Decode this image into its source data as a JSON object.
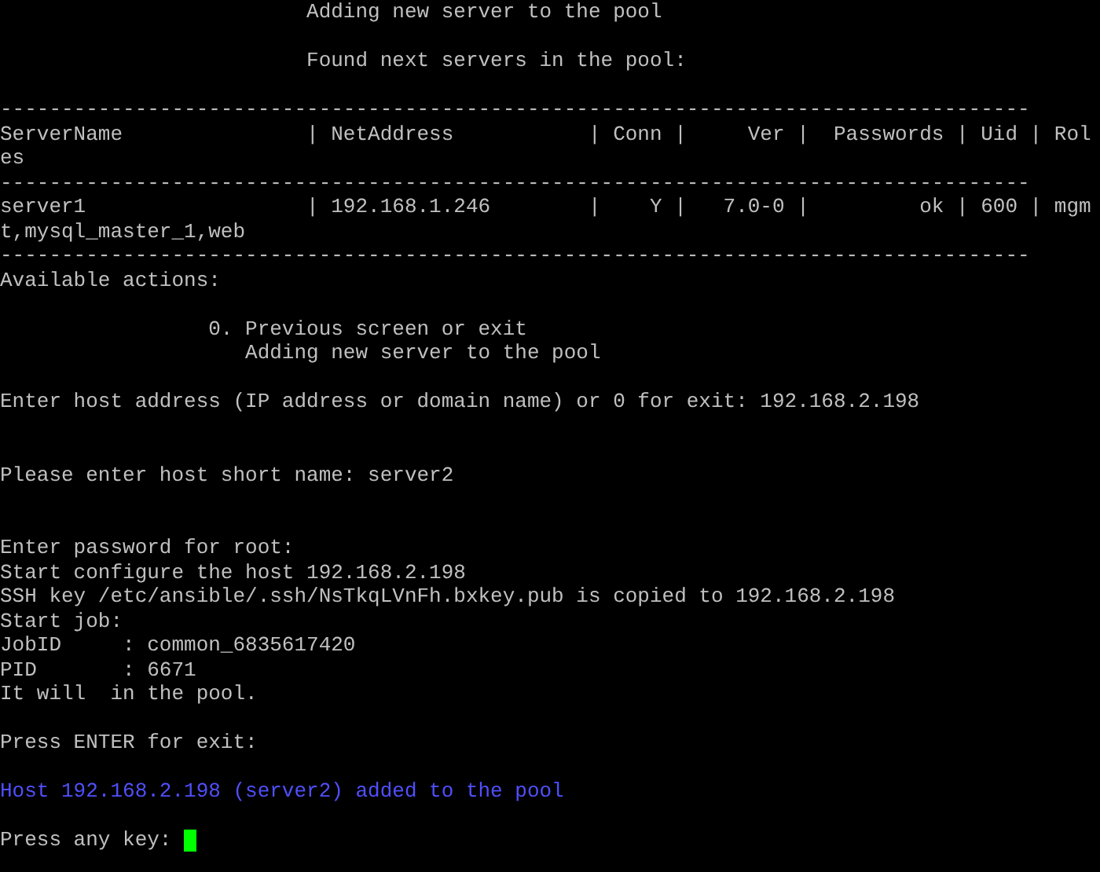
{
  "terminal": {
    "lines": [
      {
        "kind": "text",
        "text": "                         Adding new server to the pool"
      },
      {
        "kind": "blank"
      },
      {
        "kind": "text",
        "text": "                         Found next servers in the pool:"
      },
      {
        "kind": "blank"
      },
      {
        "kind": "text",
        "text": "------------------------------------------------------------------------------------"
      },
      {
        "kind": "text",
        "text": "ServerName               | NetAddress           | Conn |     Ver |  Passwords | Uid | Rol"
      },
      {
        "kind": "text",
        "text": "es"
      },
      {
        "kind": "text",
        "text": "------------------------------------------------------------------------------------"
      },
      {
        "kind": "text",
        "text": "server1                  | 192.168.1.246        |    Y |   7.0-0 |         ok | 600 | mgm"
      },
      {
        "kind": "text",
        "text": "t,mysql_master_1,web"
      },
      {
        "kind": "text",
        "text": "------------------------------------------------------------------------------------"
      },
      {
        "kind": "text",
        "text": "Available actions:"
      },
      {
        "kind": "blank"
      },
      {
        "kind": "text",
        "text": "                 0. Previous screen or exit"
      },
      {
        "kind": "text",
        "text": "                    Adding new server to the pool"
      },
      {
        "kind": "blank"
      },
      {
        "kind": "text",
        "text": "Enter host address (IP address or domain name) or 0 for exit: 192.168.2.198"
      },
      {
        "kind": "blank"
      },
      {
        "kind": "blank"
      },
      {
        "kind": "text",
        "text": "Please enter host short name: server2"
      },
      {
        "kind": "blank"
      },
      {
        "kind": "blank"
      },
      {
        "kind": "text",
        "text": "Enter password for root:"
      },
      {
        "kind": "text",
        "text": "Start configure the host 192.168.2.198"
      },
      {
        "kind": "text",
        "text": "SSH key /etc/ansible/.ssh/NsTkqLVnFh.bxkey.pub is copied to 192.168.2.198"
      },
      {
        "kind": "text",
        "text": "Start job:"
      },
      {
        "kind": "text",
        "text": "JobID     : common_6835617420"
      },
      {
        "kind": "text",
        "text": "PID       : 6671"
      },
      {
        "kind": "text",
        "text": "It will  in the pool."
      },
      {
        "kind": "blank"
      },
      {
        "kind": "text",
        "text": "Press ENTER for exit:"
      },
      {
        "kind": "blank"
      },
      {
        "kind": "highlight",
        "text": "Host 192.168.2.198 (server2) added to the pool"
      },
      {
        "kind": "blank"
      },
      {
        "kind": "prompt",
        "text": "Press any key:"
      }
    ]
  }
}
